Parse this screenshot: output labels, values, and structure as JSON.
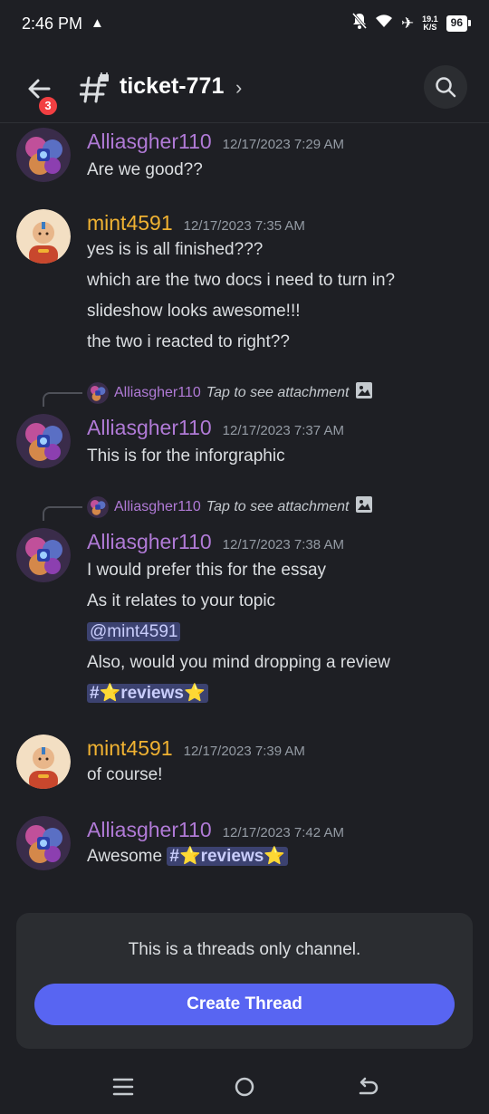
{
  "status_bar": {
    "time": "2:46 PM",
    "net_speed_value": "19.1",
    "net_speed_unit": "K/S",
    "battery": "96"
  },
  "header": {
    "channel_name": "ticket-771",
    "notification_count": "3"
  },
  "messages": [
    {
      "author": "Alliasgher110",
      "author_color": "#b07ad6",
      "timestamp": "12/17/2023 7:29 AM",
      "lines": [
        "Are we good??"
      ]
    },
    {
      "author": "mint4591",
      "author_color": "#f0b232",
      "timestamp": "12/17/2023 7:35 AM",
      "lines": [
        "yes is is all finished???",
        "which are the two docs i need to turn in?",
        "slideshow looks awesome!!!",
        "the two i reacted to right??"
      ]
    },
    {
      "reply": {
        "author": "Alliasgher110",
        "text": "Tap to see attachment"
      },
      "author": "Alliasgher110",
      "timestamp": "12/17/2023 7:37 AM",
      "lines": [
        "This is for the inforgraphic"
      ]
    },
    {
      "reply": {
        "author": "Alliasgher110",
        "text": "Tap to see attachment"
      },
      "author": "Alliasgher110",
      "timestamp": "12/17/2023 7:38 AM",
      "lines": [
        "I would prefer this for the essay",
        "As it relates to your topic",
        "@mint4591",
        "Also, would you mind dropping a review",
        "#⭐reviews⭐"
      ]
    },
    {
      "author": "mint4591",
      "timestamp": "12/17/2023 7:39 AM",
      "lines": [
        "of course!"
      ]
    },
    {
      "author": "Alliasgher110",
      "timestamp": "12/17/2023 7:42 AM",
      "lines": [
        "Awesome",
        "#⭐reviews⭐"
      ]
    }
  ],
  "threads_card": {
    "message": "This is a threads only channel.",
    "button_label": "Create Thread"
  },
  "colors": {
    "background": "#1e1f24",
    "accent": "#5865f2",
    "mention_bg": "#3c4270",
    "badge": "#f23f42"
  }
}
